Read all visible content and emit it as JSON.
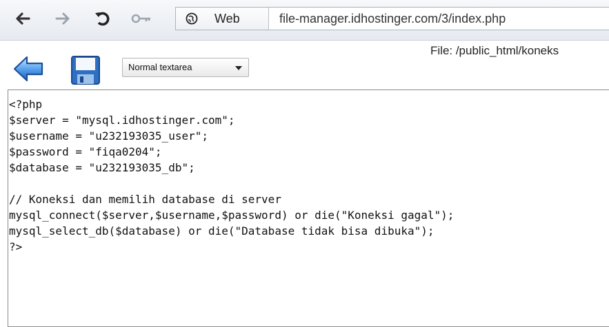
{
  "browser": {
    "site_label": "Web",
    "url": "file-manager.idhostinger.com/3/index.php",
    "icons": [
      "back-arrow-icon",
      "forward-arrow-icon",
      "reload-icon",
      "key-icon",
      "globe-icon"
    ]
  },
  "toolbar": {
    "editor_mode": "Normal textarea",
    "file_path": "File: /public_html/koneks",
    "icons": [
      "blue-back-arrow-icon",
      "floppy-save-icon"
    ]
  },
  "editor": {
    "lines": [
      "<?php",
      "$server = \"mysql.idhostinger.com\";",
      "$username = \"u232193035_user\";",
      "$password = \"fiqa0204\";",
      "$database = \"u232193035_db\";",
      "",
      "// Koneksi dan memilih database di server",
      "mysql_connect($server,$username,$password) or die(\"Koneksi gagal\");",
      "mysql_select_db($database) or die(\"Database tidak bisa dibuka\");",
      "?>"
    ]
  },
  "colors": {
    "toolbar_bg": "#e6eaf0",
    "arrow_blue": "#2f7ad6",
    "editor_border": "#8a8a8a"
  }
}
